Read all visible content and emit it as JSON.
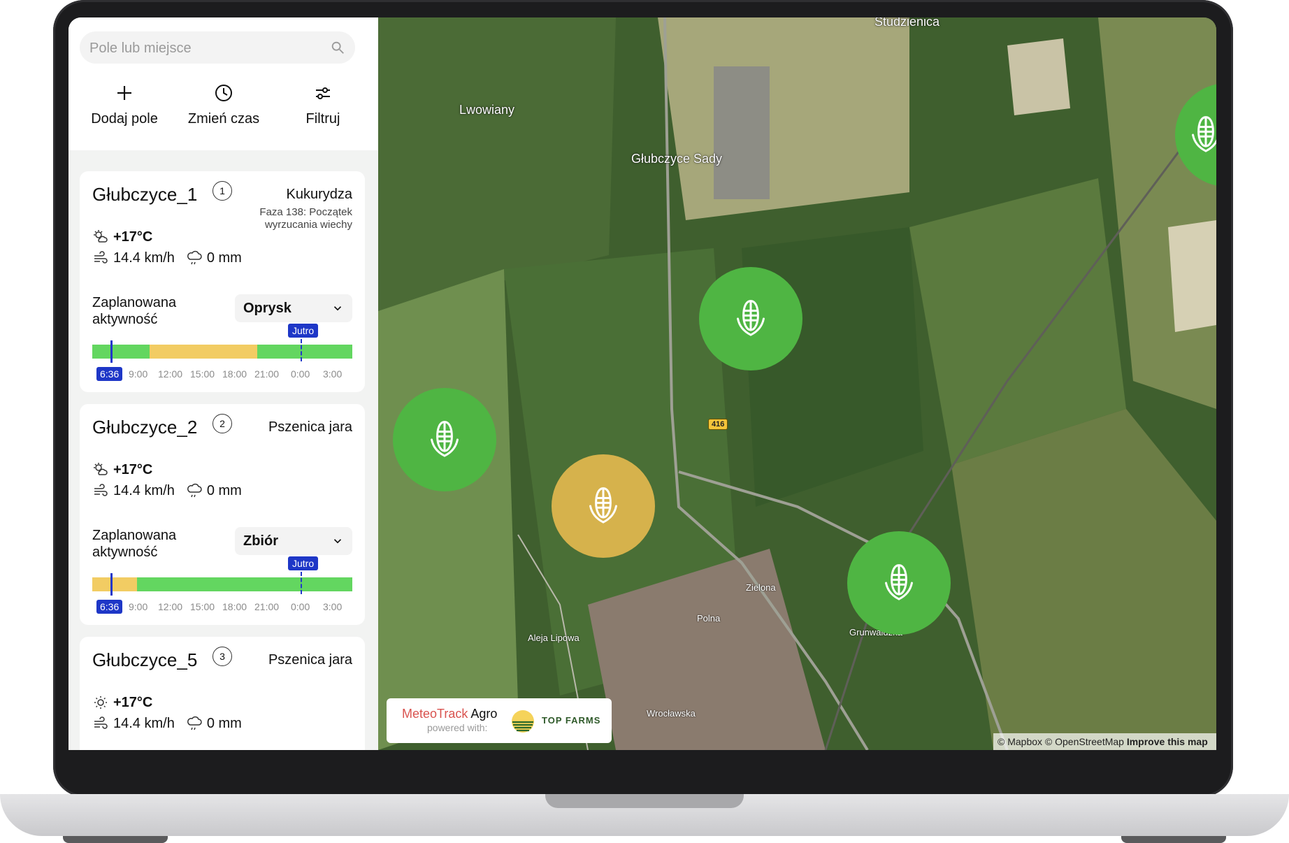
{
  "sidebar": {
    "search": {
      "placeholder": "Pole lub miejsce"
    },
    "actions": [
      {
        "label": "Dodaj pole",
        "icon": "plus-icon"
      },
      {
        "label": "Zmień czas",
        "icon": "clock-icon"
      },
      {
        "label": "Filtruj",
        "icon": "sliders-icon"
      }
    ]
  },
  "fields": [
    {
      "name": "Głubczyce_1",
      "number": "1",
      "crop": "Kukurydza",
      "phase": "Faza 138: Początek\nwyrzucania wiechy",
      "temp": "+17°C",
      "wind": "14.4 km/h",
      "rain": "0 mm",
      "activity_label": "Zaplanowana aktywność",
      "activity": "Oprysk",
      "now_badge": "6:36",
      "tomorrow_badge": "Jutro",
      "timeline_status": [
        "green",
        "yellow",
        "green"
      ]
    },
    {
      "name": "Głubczyce_2",
      "number": "2",
      "crop": "Pszenica jara",
      "phase": "",
      "temp": "+17°C",
      "wind": "14.4 km/h",
      "rain": "0 mm",
      "activity_label": "Zaplanowana aktywność",
      "activity": "Zbiór",
      "now_badge": "6:36",
      "tomorrow_badge": "Jutro",
      "timeline_status": [
        "yellow",
        "green"
      ]
    },
    {
      "name": "Głubczyce_5",
      "number": "3",
      "crop": "Pszenica jara",
      "phase": "",
      "temp": "+17°C",
      "wind": "14.4 km/h",
      "rain": "0 mm"
    }
  ],
  "timeline_ticks": [
    "9:00",
    "12:00",
    "15:00",
    "18:00",
    "21:00",
    "0:00",
    "3:00"
  ],
  "colors": {
    "green": "#63d660",
    "yellow": "#f2cc63",
    "marker_green": "#4fb543",
    "marker_yellow": "#d6b24c",
    "accent_blue": "#1e37c7"
  },
  "map": {
    "places": [
      "Studzienica",
      "Lwowiany",
      "Głubczyce Sady"
    ],
    "roads": [
      "Zielona",
      "Polna",
      "Grunwaldzka",
      "Aleja Lipowa",
      "Wrocławska"
    ],
    "road_shield": "416",
    "markers": [
      {
        "icon": "corn-icon",
        "status": "green"
      },
      {
        "icon": "corn-icon",
        "status": "green"
      },
      {
        "icon": "corn-icon",
        "status": "yellow"
      },
      {
        "icon": "corn-icon",
        "status": "green"
      },
      {
        "icon": "corn-icon",
        "status": "green"
      }
    ],
    "brand": {
      "name_colored": "MeteoTrack",
      "name_dark": "Agro",
      "powered": "powered with:",
      "partner": "TOP FARMS"
    },
    "attribution": {
      "text": "© Mapbox © OpenStreetMap",
      "link": "Improve this map"
    }
  }
}
